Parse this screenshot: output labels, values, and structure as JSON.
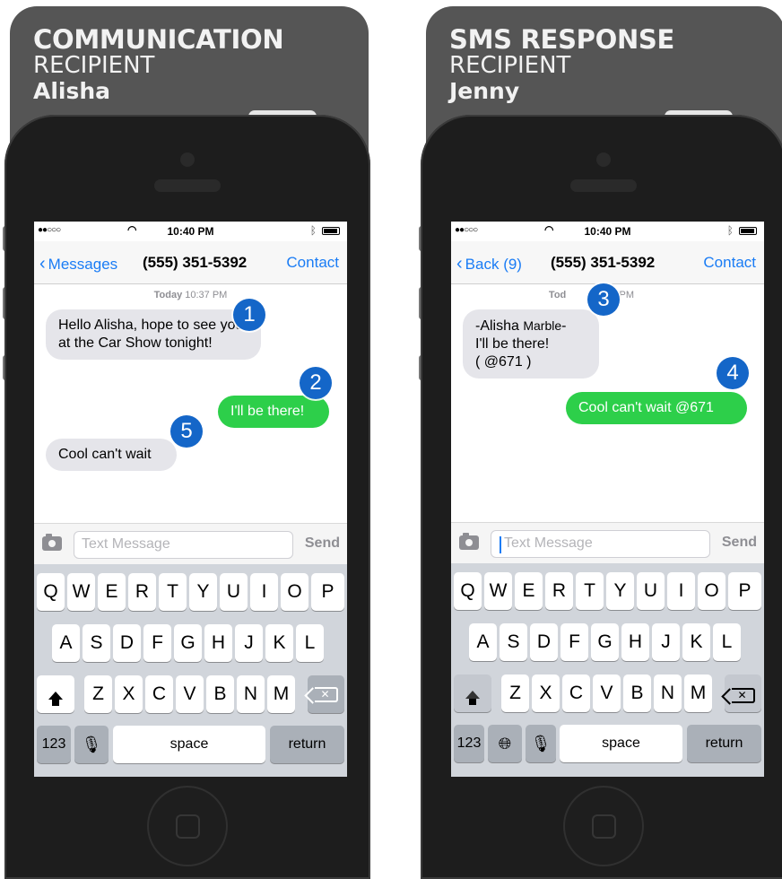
{
  "left": {
    "card": {
      "title": "COMMUNICATION",
      "subtitle": "RECIPIENT",
      "name": "Alisha"
    },
    "status": {
      "time": "10:40 PM"
    },
    "nav": {
      "back": "Messages",
      "title": "(555) 351-5392",
      "contact": "Contact"
    },
    "timestamp": {
      "day": "Today",
      "time": "10:37 PM"
    },
    "messages": [
      {
        "text": "Hello Alisha, hope to see you at the Car Show tonight!",
        "badge": "1"
      },
      {
        "text": "I'll be there!",
        "badge": "2"
      },
      {
        "text": "Cool can't wait",
        "badge": "5"
      }
    ],
    "input": {
      "placeholder": "Text Message",
      "send": "Send"
    },
    "keyboard": {
      "row1": [
        "Q",
        "W",
        "E",
        "R",
        "T",
        "Y",
        "U",
        "I",
        "O",
        "P"
      ],
      "row2": [
        "A",
        "S",
        "D",
        "F",
        "G",
        "H",
        "J",
        "K",
        "L"
      ],
      "row3": [
        "Z",
        "X",
        "C",
        "V",
        "B",
        "N",
        "M"
      ],
      "num": "123",
      "space": "space",
      "return": "return"
    }
  },
  "right": {
    "card": {
      "title": "SMS RESPONSE",
      "subtitle": "RECIPIENT",
      "name": "Jenny"
    },
    "status": {
      "time": "10:40 PM"
    },
    "nav": {
      "back": "Back (9)",
      "title": "(555) 351-5392",
      "contact": "Contact"
    },
    "timestamp": {
      "day": "Tod",
      "time": "38 PM"
    },
    "messages": [
      {
        "line1a": "-Alisha ",
        "line1b": "Marble",
        "line1c": "-",
        "line2": "I'll be there!",
        "line3": "( @671 )",
        "badge": "3"
      },
      {
        "text": "Cool can't wait @671",
        "badge": "4"
      }
    ],
    "input": {
      "placeholder": "Text Message",
      "send": "Send"
    },
    "keyboard": {
      "row1": [
        "Q",
        "W",
        "E",
        "R",
        "T",
        "Y",
        "U",
        "I",
        "O",
        "P"
      ],
      "row2": [
        "A",
        "S",
        "D",
        "F",
        "G",
        "H",
        "J",
        "K",
        "L"
      ],
      "row3": [
        "Z",
        "X",
        "C",
        "V",
        "B",
        "N",
        "M"
      ],
      "num": "123",
      "space": "space",
      "return": "return"
    }
  }
}
